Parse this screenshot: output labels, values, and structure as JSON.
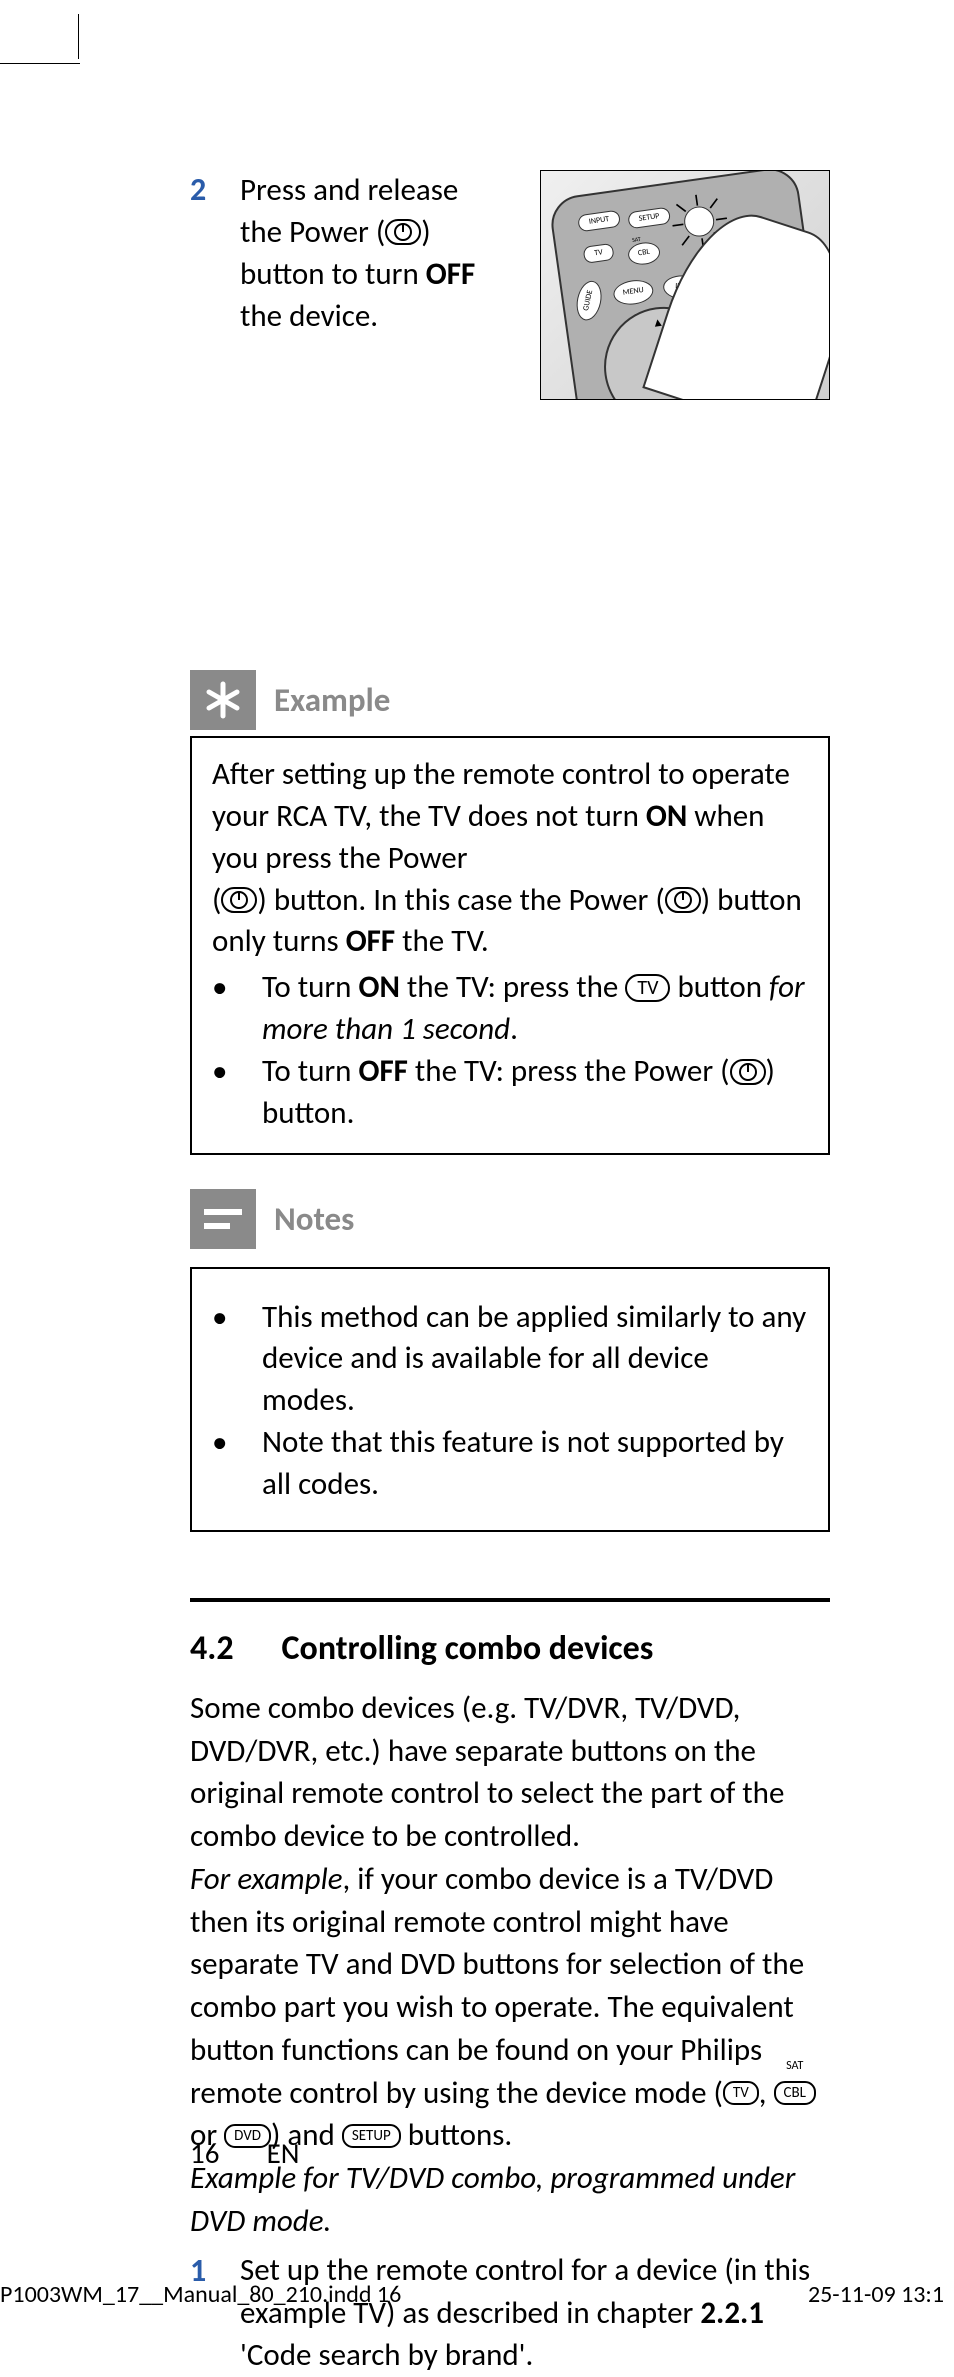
{
  "step2": {
    "num": "2",
    "line1a": "Press and release ",
    "line1b": "the Power (",
    "line1c": ") ",
    "line1d": "button to turn ",
    "line1e": "OFF",
    "line1f": " the device."
  },
  "remote_labels": {
    "input": "INPUT",
    "setup": "SETUP",
    "tv": "TV",
    "sat": "SAT",
    "cbl": "CBL",
    "menu": "MENU",
    "info": "INFO",
    "guide": "GUIDE"
  },
  "example": {
    "heading": "Example",
    "p1a": "After setting up the remote control to operate your RCA TV, the TV does not turn ",
    "p1b": "ON",
    "p1c": " when you press the Power ",
    "p2a": "(",
    "p2b": ") button. In this case the Power (",
    "p2c": ") button only turns ",
    "p2d": "OFF",
    "p2e": " the TV.",
    "li1a": "To turn ",
    "li1b": "ON",
    "li1c": " the TV: press the ",
    "li1_tv": "TV",
    "li1d": " button ",
    "li1e": "for more than 1 second",
    "li1f": ".",
    "li2a": "To turn ",
    "li2b": "OFF",
    "li2c": " the TV: press the Power (",
    "li2d": ") button."
  },
  "notes": {
    "heading": "Notes",
    "li1": "This method can be applied similarly to any device and is available for all device modes.",
    "li2": "Note that this feature is not supported by all codes."
  },
  "section42": {
    "num": "4.2",
    "title": "Controlling combo devices",
    "p1": "Some combo devices (e.g. TV/DVR, TV/DVD, DVD/DVR, etc.) have separate buttons on the original remote control to select the part of the combo device to be controlled.",
    "p2a": "For example",
    "p2b": ", if your combo device is a TV/DVD then its original remote control might have separate TV and DVD buttons for selection of the combo part you wish to operate. The equivalent button functions can be found on your Philips remote control by using the device mode (",
    "tv": "TV",
    "comma1": ", ",
    "cbl": "CBL",
    "sat": "SAT",
    "or": " or ",
    "dvd": "DVD",
    "p2c": ") and ",
    "setup": "SETUP",
    "p2d": " buttons.",
    "p3": "Example for TV/DVD combo, programmed under DVD mode.",
    "step1_num": "1",
    "step1a": "Set up the remote control for a device (in this example TV) as described in chapter ",
    "step1b": "2.2.1",
    "step1c": " 'Code search by brand'."
  },
  "footer": {
    "page": "16",
    "lang": "EN"
  },
  "imprint": {
    "file": "P1003WM_17__Manual_80_210.indd   16",
    "date": "25-11-09   13:1"
  }
}
